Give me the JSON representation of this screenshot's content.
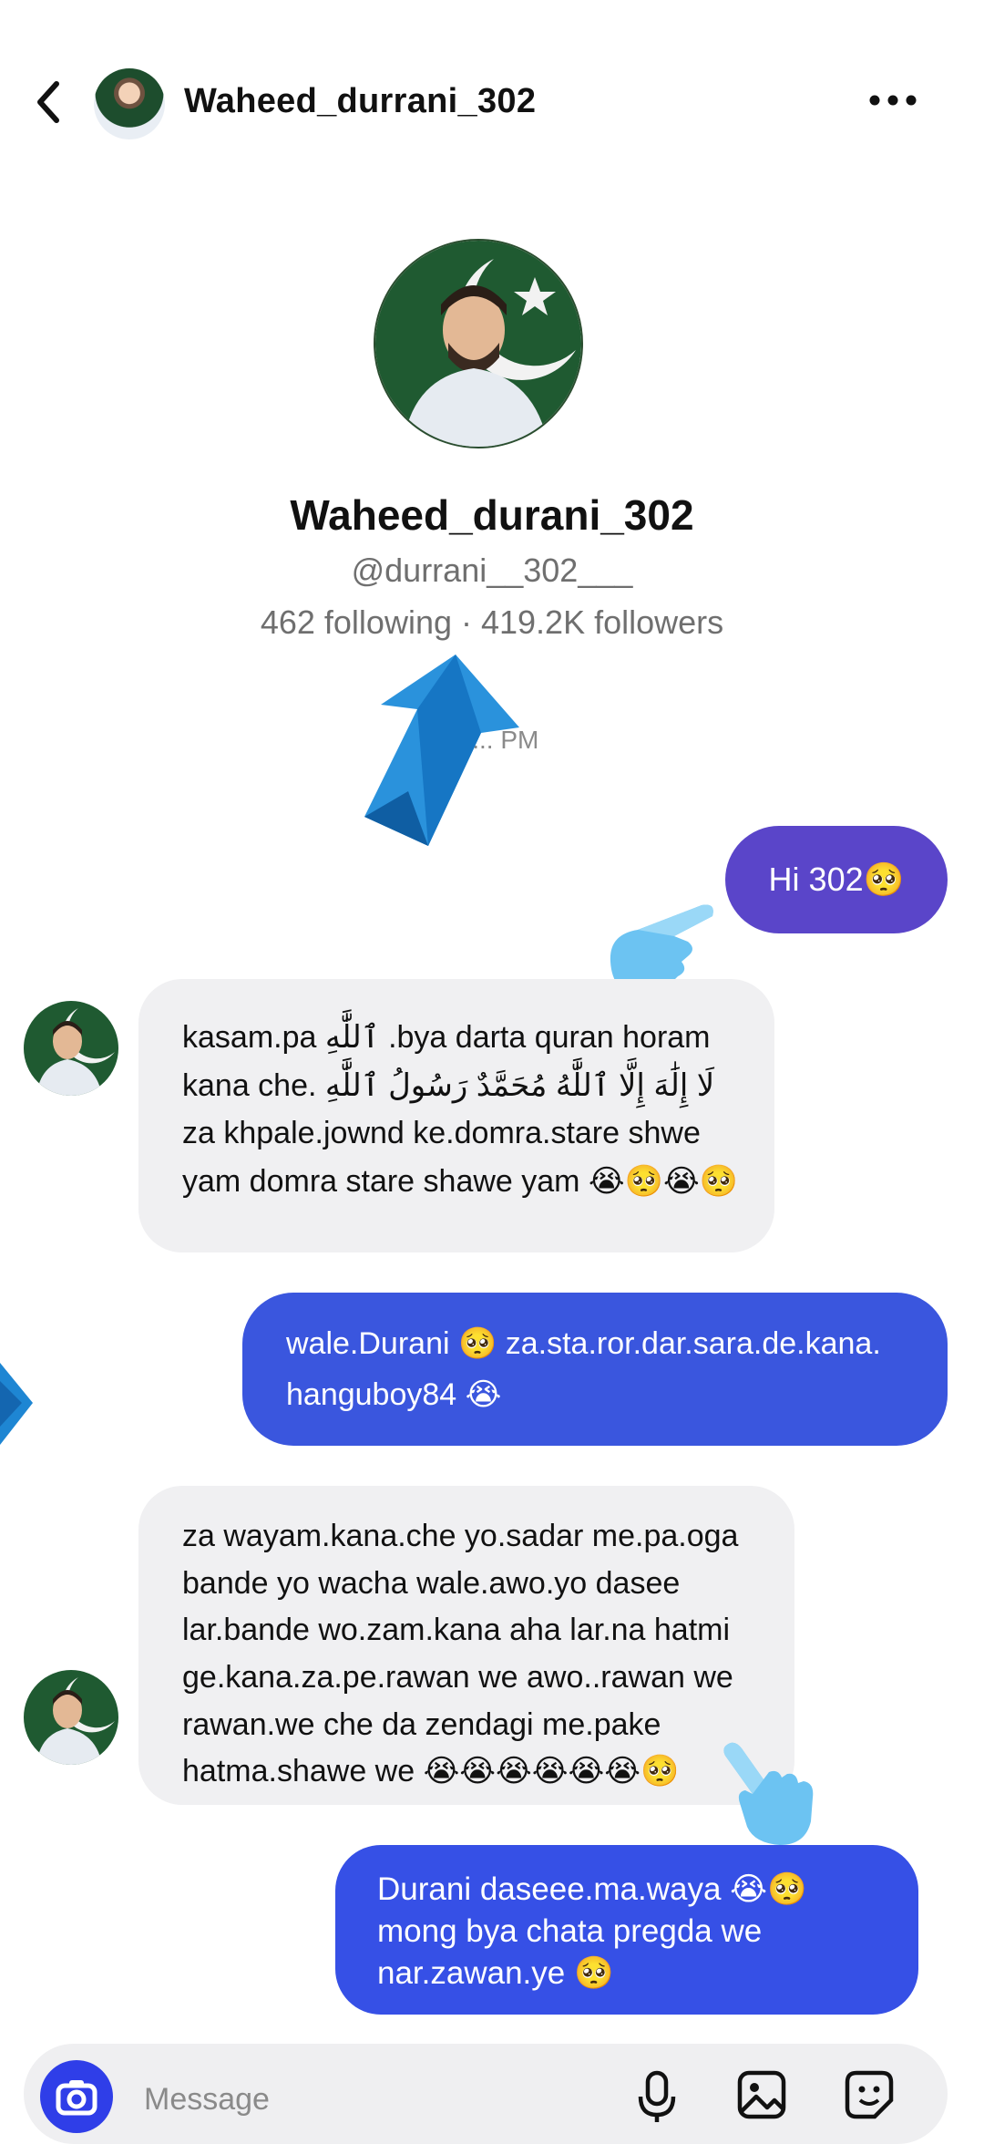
{
  "header": {
    "username": "Waheed_durrani_302",
    "back_icon": "chevron-left-icon",
    "more_icon": "more-horizontal-icon"
  },
  "profile": {
    "display_name": "Waheed_durani_302",
    "handle": "@durrani__302___",
    "stats": "462 following · 419.2K followers"
  },
  "timestamp": "To... PM",
  "messages": [
    {
      "direction": "outgoing",
      "lines": [
        "Hi 302🥺"
      ]
    },
    {
      "direction": "incoming",
      "lines": [
        "kasam.pa ٱللَّٰهِ .bya darta quran horam",
        "kana che. لَا إِلَٰهَ إِلَّا ٱللَّٰهُ مُحَمَّدٌ رَسُولُ ٱللَّٰهِ",
        "za khpale.jownd ke.domra.stare shwe",
        "yam domra stare  shawe yam 😭🥺😭🥺"
      ]
    },
    {
      "direction": "outgoing",
      "lines": [
        "wale.Durani 🥺 za.sta.ror.dar.sara.de.kana.",
        "hanguboy84 😭"
      ]
    },
    {
      "direction": "incoming",
      "lines": [
        "za wayam.kana.che yo.sadar me.pa.oga",
        "bande yo wacha wale.awo.yo dasee",
        "lar.bande wo.zam.kana  aha lar.na hatmi",
        "ge.kana.za.pe.rawan we awo..rawan we",
        "rawan.we che da zendagi me.pake",
        "hatma.shawe we 😭😭😭😭😭😭🥺"
      ]
    },
    {
      "direction": "outgoing",
      "lines": [
        "Durani  daseee.ma.waya 😭🥺",
        "mong bya chata pregda we",
        "nar.zawan.ye 🥺"
      ]
    }
  ],
  "composer": {
    "placeholder": "Message",
    "camera_icon": "camera-icon",
    "mic_icon": "microphone-icon",
    "gallery_icon": "image-icon",
    "sticker_icon": "sticker-icon"
  },
  "colors": {
    "outgoing_1": "#5a45c9",
    "outgoing_2": "#3a56de",
    "incoming": "#f0f0f2",
    "camera_button": "#2f3ee8"
  }
}
